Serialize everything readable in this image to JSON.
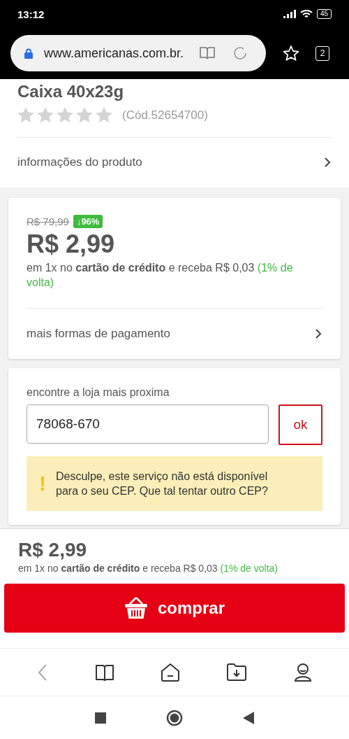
{
  "status_bar": {
    "time": "13:12",
    "battery": "45"
  },
  "browser": {
    "url": "www.americanas.com.br.",
    "tab_count": "2"
  },
  "product": {
    "title": "Caixa 40x23g",
    "stars": 0,
    "code": "(Cód.52654700)",
    "info_link": "informações do produto"
  },
  "price_card": {
    "old_price": "R$ 79,99",
    "discount": "↓96%",
    "price": "R$ 2,99",
    "installment": "em 1x no **cartão de crédito** e receba R$ 0,03",
    "cashback": "(1% de volta)",
    "more_payment": "mais formas de pagamento"
  },
  "store_card": {
    "label": "encontre a loja mais proxima",
    "cep_value": "78068-670",
    "ok_button": "ok",
    "warning_icon": "!",
    "warning": "Desculpe, este serviço não está disponível para o seu CEP. Que tal tentar outro CEP?"
  },
  "buy_bar": {
    "price": "R$ 2,99",
    "installment": "em 1x no **cartão de crédito** e receba R$ 0,03",
    "cashback": "(1% de volta)",
    "button": "comprar"
  }
}
